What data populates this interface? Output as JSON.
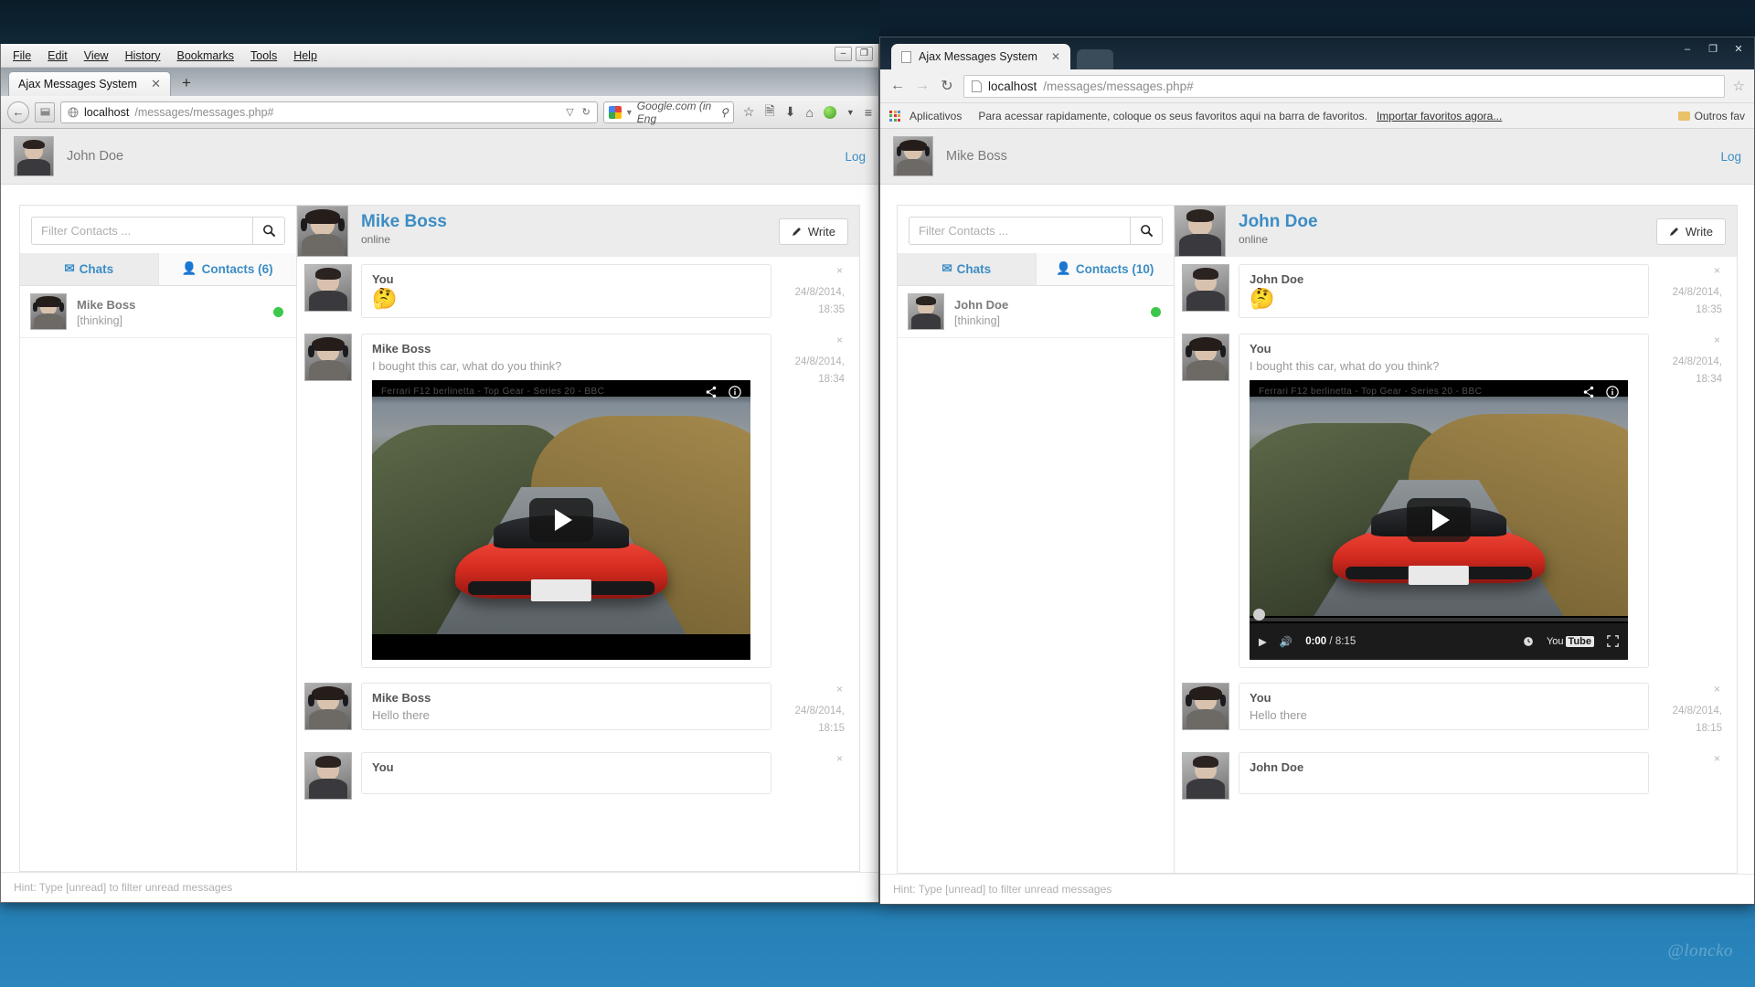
{
  "desktop": {
    "watermark": "@loncko"
  },
  "firefox": {
    "menu": [
      "File",
      "Edit",
      "View",
      "History",
      "Bookmarks",
      "Tools",
      "Help"
    ],
    "window_controls": [
      "–",
      "❐",
      "✕"
    ],
    "tab_title": "Ajax Messages System",
    "tab_close": "✕",
    "new_tab": "+",
    "url_host": "localhost",
    "url_path": "/messages/messages.php#",
    "url_dropdown": "▽",
    "url_reload": "↻",
    "search_placeholder": "Google.com (in Eng",
    "search_icon": "⚲",
    "toolbar_icons": [
      "star-icon",
      "library-icon",
      "download-icon",
      "home-icon",
      "orb-icon",
      "dropdown-icon",
      "menu-icon"
    ]
  },
  "chrome": {
    "tab_title": "Ajax Messages System",
    "tab_close": "✕",
    "window_controls": [
      "–",
      "❐",
      "✕"
    ],
    "back_icon": "←",
    "forward_icon": "→",
    "reload_icon": "↻",
    "url_host": "localhost",
    "url_path": "/messages/messages.php#",
    "star_icon": "☆",
    "bookmarks": {
      "apps_label": "Aplicativos",
      "hint": "Para acessar rapidamente, coloque os seus favoritos aqui na barra de favoritos.",
      "import_link": "Importar favoritos agora...",
      "other_folder": "Outros fav"
    }
  },
  "app_left": {
    "header": {
      "user": "John Doe",
      "logout": "Log"
    },
    "filter": {
      "placeholder": "Filter Contacts ...",
      "value": "",
      "search_icon": "⚲"
    },
    "tabs": [
      {
        "label": "Chats",
        "icon": "envelope-icon",
        "active": true
      },
      {
        "label": "Contacts (6)",
        "icon": "person-icon",
        "active": false
      }
    ],
    "chats": [
      {
        "name": "Mike Boss",
        "preview": "[thinking]",
        "online": true
      }
    ],
    "conversation": {
      "title": "Mike Boss",
      "status": "online",
      "write_label": "Write",
      "write_icon": "pencil-icon",
      "messages": [
        {
          "sender": "You",
          "text": "",
          "emoji": "🤔",
          "time": "24/8/2014, 18:35",
          "close": "×",
          "has_video": false
        },
        {
          "sender": "Mike Boss",
          "text": "I bought this car, what do you think?",
          "emoji": "",
          "time": "24/8/2014, 18:34",
          "close": "×",
          "has_video": true
        },
        {
          "sender": "Mike Boss",
          "text": "Hello there",
          "emoji": "",
          "time": "24/8/2014, 18:15",
          "close": "×",
          "has_video": false
        },
        {
          "sender": "You",
          "text": "",
          "emoji": "",
          "time": "",
          "close": "×",
          "has_video": false
        }
      ]
    },
    "hint": "Hint: Type [unread] to filter unread messages"
  },
  "app_right": {
    "header": {
      "user": "Mike Boss",
      "logout": "Log"
    },
    "filter": {
      "placeholder": "Filter Contacts ...",
      "value": "",
      "search_icon": "⚲"
    },
    "tabs": [
      {
        "label": "Chats",
        "icon": "envelope-icon",
        "active": true
      },
      {
        "label": "Contacts (10)",
        "icon": "person-icon",
        "active": false
      }
    ],
    "chats": [
      {
        "name": "John Doe",
        "preview": "[thinking]",
        "online": true
      }
    ],
    "conversation": {
      "title": "John Doe",
      "status": "online",
      "write_label": "Write",
      "write_icon": "pencil-icon",
      "messages": [
        {
          "sender": "John Doe",
          "text": "",
          "emoji": "🤔",
          "time": "24/8/2014, 18:35",
          "close": "×",
          "has_video": false
        },
        {
          "sender": "You",
          "text": "I bought this car, what do you think?",
          "emoji": "",
          "time": "24/8/2014, 18:34",
          "close": "×",
          "has_video": true
        },
        {
          "sender": "You",
          "text": "Hello there",
          "emoji": "",
          "time": "24/8/2014, 18:15",
          "close": "×",
          "has_video": false
        },
        {
          "sender": "John Doe",
          "text": "",
          "emoji": "",
          "time": "",
          "close": "×",
          "has_video": false
        }
      ]
    },
    "hint": "Hint: Type [unread] to filter unread messages"
  },
  "video": {
    "title_overlay": "Ferrari F12 berlinetta - Top Gear - Series 20 - BBC",
    "share_icon": "share-icon",
    "info_icon": "info-icon",
    "play_icon": "play-icon",
    "controls": {
      "play": "▶",
      "volume": "🔊",
      "current_time": "0:00",
      "separator": "/",
      "duration": "8:15",
      "settings_icon": "clock-icon",
      "brand": "You",
      "brand_box": "Tube",
      "fullscreen_icon": "fullscreen-icon"
    }
  },
  "colors": {
    "accent": "#3c8dc5",
    "online": "#3cc84a",
    "muted": "#9a9a9a"
  }
}
